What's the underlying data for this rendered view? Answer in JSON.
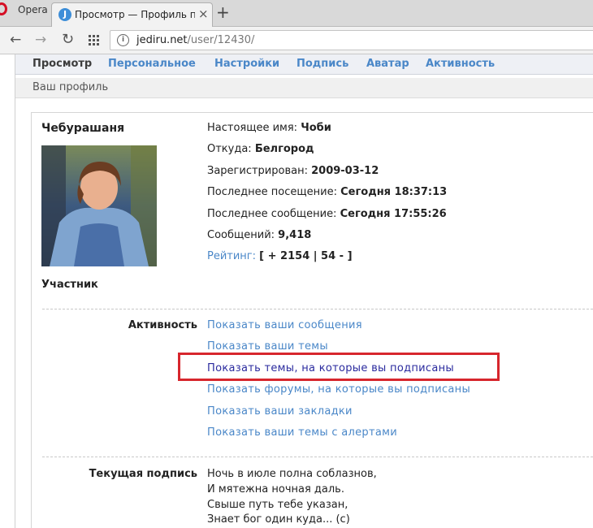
{
  "browser": {
    "name": "Opera",
    "tab_title": "Просмотр — Профиль пол",
    "tab_favicon": "J",
    "new_tab": "+",
    "close": "×",
    "url_host": "jediru.net",
    "url_path": "/user/12430/"
  },
  "nav_tabs": [
    "Просмотр",
    "Персональное",
    "Настройки",
    "Подпись",
    "Аватар",
    "Активность"
  ],
  "breadcrumb": "Ваш профиль",
  "profile": {
    "username": "Чебурашаня",
    "user_title": "Участник",
    "fields": [
      {
        "label": "Настоящее имя:",
        "value": "Чоби"
      },
      {
        "label": "Откуда:",
        "value": "Белгород"
      },
      {
        "label": "Зарегистрирован:",
        "value": "2009-03-12"
      },
      {
        "label": "Последнее посещение:",
        "value": "Сегодня 18:37:13"
      },
      {
        "label": "Последнее сообщение:",
        "value": "Сегодня 17:55:26"
      },
      {
        "label": "Сообщений:",
        "value": "9,418"
      }
    ],
    "rating_label": "Рейтинг:",
    "rating_value": "[ + 2154 | 54 - ]"
  },
  "activity": {
    "label": "Активность",
    "links": [
      "Показать ваши сообщения",
      "Показать ваши темы",
      "Показать темы, на которые вы подписаны",
      "Показать форумы, на которые вы подписаны",
      "Показать ваши закладки",
      "Показать ваши темы с алертами"
    ]
  },
  "signature": {
    "label": "Текущая подпись",
    "lines": [
      "Ночь в июле полна соблазнов,",
      "И мятежна ночная даль.",
      "Свыше путь тебе указан,",
      "Знает бог один куда... (с)"
    ]
  },
  "colors": {
    "link": "#4a87c8",
    "highlight_box": "#d7262d",
    "visited_link": "#2a2a9e"
  }
}
